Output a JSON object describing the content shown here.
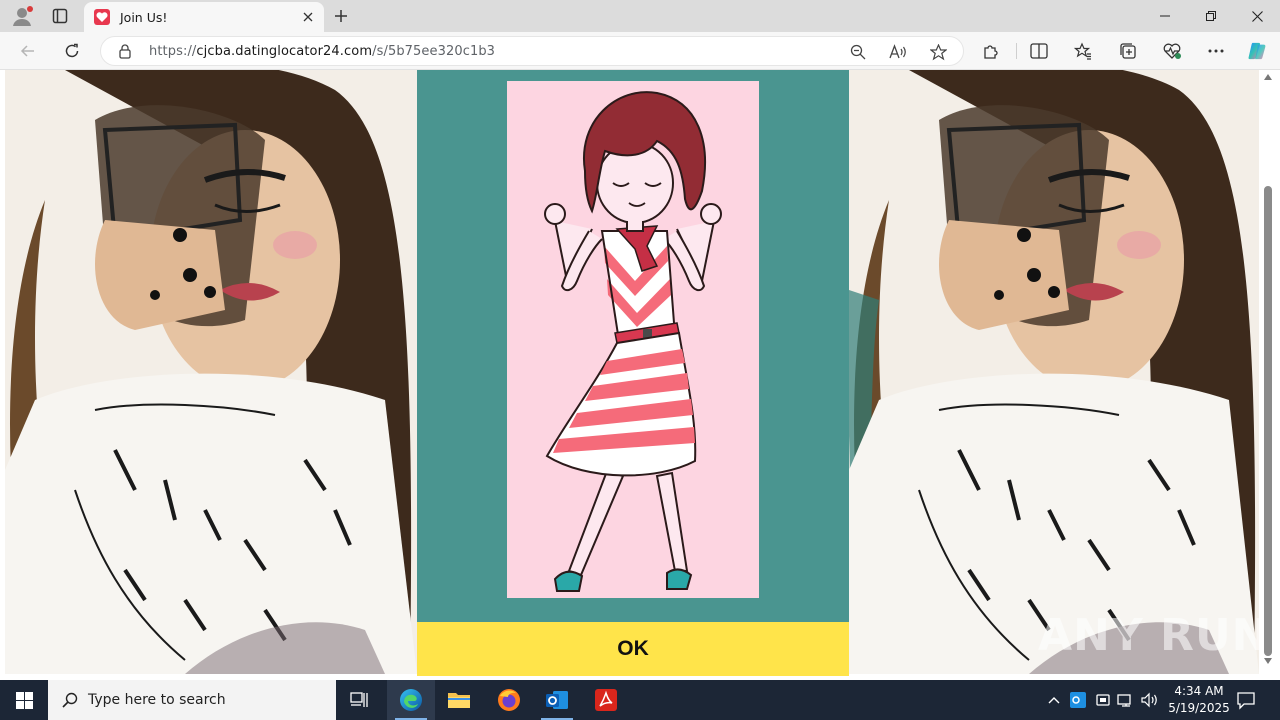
{
  "browser": {
    "tab_title": "Join Us!",
    "url_prefix": "https://",
    "url_host": "cjcba.datinglocator24.com",
    "url_path": "/s/5b75ee320c1b3"
  },
  "page": {
    "ok_label": "OK",
    "panel_color": "#4a9590",
    "card_color": "#fdd5e1",
    "ok_color": "#ffe44a"
  },
  "watermark": "ANY RUN",
  "taskbar": {
    "search_placeholder": "Type here to search",
    "time": "4:34 AM",
    "date": "5/19/2025"
  },
  "icons": {
    "profile": "profile-icon",
    "tabs": "tab-actions-icon",
    "favicon": "heart-favicon",
    "back": "back-arrow-icon",
    "refresh": "refresh-icon",
    "lock": "lock-icon",
    "zoom": "zoom-icon",
    "read_aloud": "read-aloud-icon",
    "favorite": "star-icon",
    "extensions": "puzzle-icon",
    "split": "split-screen-icon",
    "favorites": "favorites-icon",
    "collections": "collections-icon",
    "performance": "heart-pulse-icon",
    "more": "ellipsis-icon",
    "copilot": "copilot-icon"
  }
}
